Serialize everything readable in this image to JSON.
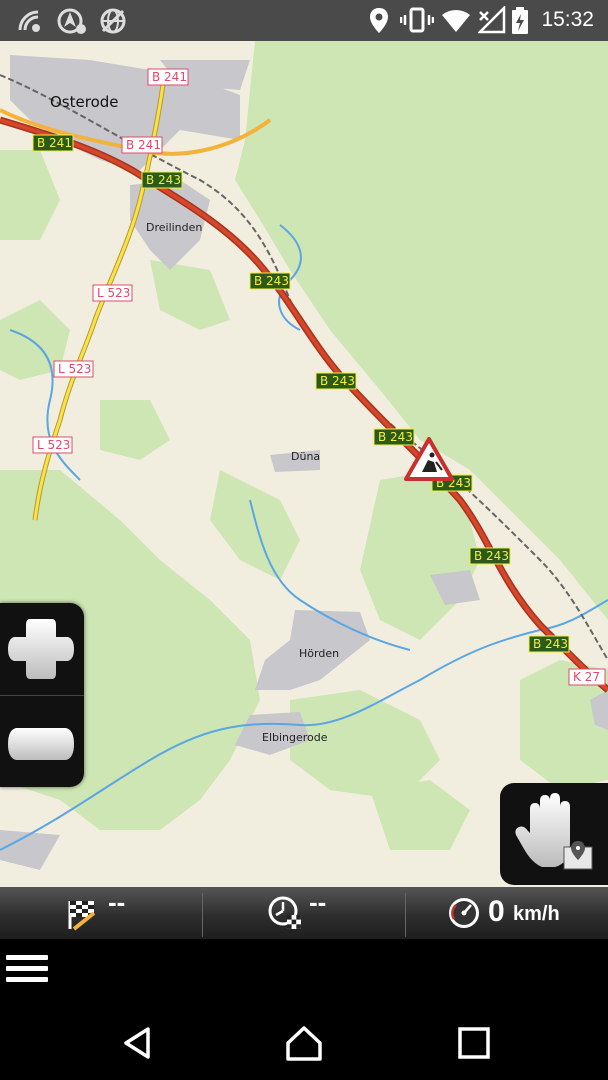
{
  "status_bar": {
    "time": "15:32",
    "left_icons": [
      "signal-scan-icon",
      "navigation-gear-icon",
      "globe-crossed-icon"
    ],
    "right_icons": [
      "location-pin-icon",
      "vibrate-icon",
      "wifi-icon",
      "cell-signal-icon",
      "battery-charging-icon"
    ]
  },
  "map": {
    "places": {
      "osterode": "Osterode",
      "dreilinden": "Dreilinden",
      "duna": "Düna",
      "hoerden": "Hörden",
      "elbingerode": "Elbingerode"
    },
    "road_labels": {
      "b241": "B 241",
      "b243": "B 243",
      "l523": "L 523",
      "k27": "K 27"
    },
    "warning_icon": "roadworks-warning-icon",
    "colors": {
      "land": "#f2eedf",
      "forest": "#cde6b4",
      "urban": "#c7c7cc",
      "main_road": "#d4472a",
      "primary_road": "#f5b23a",
      "secondary_road": "#f7e24a",
      "water": "#5aa6e2",
      "b_shield_bg": "#2b5a1a",
      "b_shield_text": "#f3ef3a",
      "l_shield_text": "#e04a6a"
    }
  },
  "controls": {
    "zoom_in_icon": "zoom-in-plus-icon",
    "zoom_out_icon": "zoom-out-minus-icon",
    "hand_icon": "hand-pan-map-icon"
  },
  "info_bar": {
    "distance_value": "--",
    "time_value": "--",
    "speed_value": "0",
    "speed_unit": "km/h",
    "distance_icon": "finish-flag-icon",
    "time_icon": "clock-flag-icon",
    "speed_icon": "speedometer-icon"
  },
  "menu": {
    "icon": "hamburger-menu-icon"
  },
  "nav_bar": {
    "back_icon": "back-triangle-icon",
    "home_icon": "home-icon",
    "recents_icon": "recents-square-icon"
  }
}
